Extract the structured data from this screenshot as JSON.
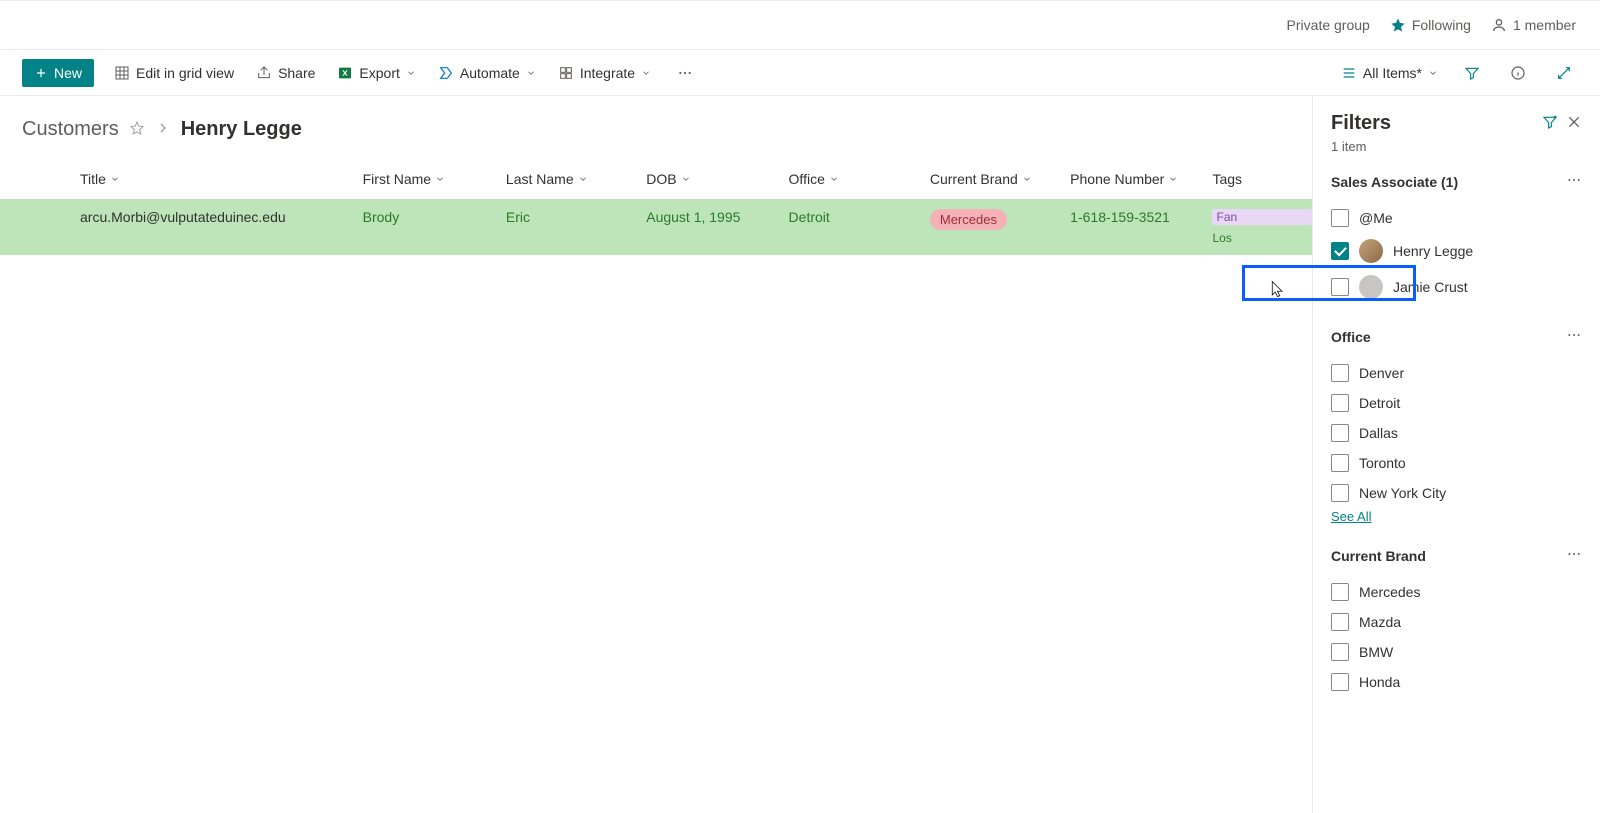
{
  "info_bar": {
    "private_group": "Private group",
    "following": "Following",
    "members": "1 member"
  },
  "toolbar": {
    "new_label": "New",
    "edit_grid": "Edit in grid view",
    "share": "Share",
    "export": "Export",
    "automate": "Automate",
    "integrate": "Integrate",
    "view_label": "All Items*"
  },
  "breadcrumb": {
    "list_name": "Customers",
    "current": "Henry Legge"
  },
  "columns": {
    "title": "Title",
    "first_name": "First Name",
    "last_name": "Last Name",
    "dob": "DOB",
    "office": "Office",
    "current_brand": "Current Brand",
    "phone": "Phone Number",
    "tags": "Tags"
  },
  "row": {
    "title": "arcu.Morbi@vulputateduinec.edu",
    "first_name": "Brody",
    "last_name": "Eric",
    "dob": "August 1, 1995",
    "office": "Detroit",
    "brand": "Mercedes",
    "phone": "1-618-159-3521",
    "tag1": "Fan",
    "tag2": "Los"
  },
  "filters": {
    "title": "Filters",
    "item_count": "1 item",
    "groups": {
      "sales_associate": {
        "label": "Sales Associate (1)",
        "options": {
          "me": "@Me",
          "henry": "Henry Legge",
          "jamie": "Jamie Crust"
        }
      },
      "office": {
        "label": "Office",
        "options": {
          "denver": "Denver",
          "detroit": "Detroit",
          "dallas": "Dallas",
          "toronto": "Toronto",
          "nyc": "New York City"
        },
        "see_all": "See All"
      },
      "current_brand": {
        "label": "Current Brand",
        "options": {
          "mercedes": "Mercedes",
          "mazda": "Mazda",
          "bmw": "BMW",
          "honda": "Honda"
        }
      }
    }
  }
}
